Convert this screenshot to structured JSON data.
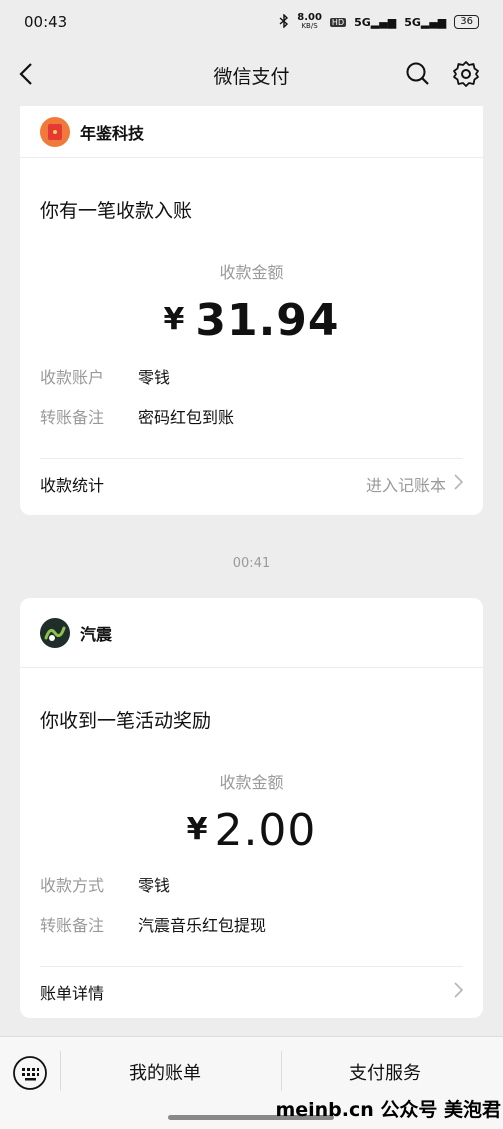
{
  "status": {
    "time": "00:43",
    "net_speed": "8.00",
    "net_unit": "KB/S",
    "hd": "HD",
    "sig1": "5G",
    "sig2": "5G",
    "battery": "36"
  },
  "nav": {
    "title": "微信支付"
  },
  "card1": {
    "brand": "年鉴科技",
    "headline": "你有一笔收款入账",
    "amount_label": "收款金额",
    "currency": "¥",
    "amount": "31.94",
    "rows": [
      {
        "key": "收款账户",
        "value": "零钱"
      },
      {
        "key": "转账备注",
        "value": "密码红包到账"
      }
    ],
    "footer_left": "收款统计",
    "footer_right": "进入记账本"
  },
  "time_separator": "00:41",
  "card2": {
    "brand": "汽震",
    "headline": "你收到一笔活动奖励",
    "amount_label": "收款金额",
    "currency": "¥",
    "amount": "2.00",
    "rows": [
      {
        "key": "收款方式",
        "value": "零钱"
      },
      {
        "key": "转账备注",
        "value": "汽震音乐红包提现"
      }
    ],
    "footer_left": "账单详情"
  },
  "bottom": {
    "tab1": "我的账单",
    "tab2": "支付服务"
  },
  "watermark": "meinb.cn 公众号 美泡君"
}
